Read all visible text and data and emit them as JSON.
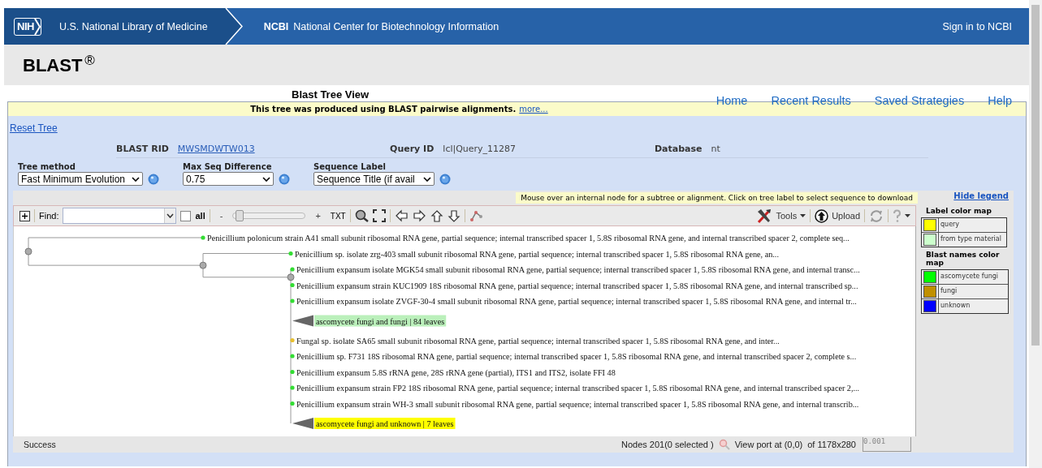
{
  "header": {
    "logo": "NIH",
    "library": "U.S. National Library of Medicine",
    "ncbi": "NCBI",
    "center": "National Center for Biotechnology Information",
    "sign_in": "Sign in to NCBI"
  },
  "app": {
    "title": "BLAST",
    "mark": "®"
  },
  "page_title": "Blast Tree View",
  "nav": [
    "Home",
    "Recent Results",
    "Saved Strategies",
    "Help"
  ],
  "notice": {
    "text": "This tree was produced using BLAST pairwise alignments.",
    "link": "more..."
  },
  "reset_link": "Reset Tree",
  "info": [
    {
      "label": "BLAST RID",
      "value": "MWSMDWTW013",
      "kind": "link"
    },
    {
      "label": "Query ID",
      "value": "lcl|Query_11287",
      "kind": "text"
    },
    {
      "label": "Database",
      "value": "nt",
      "kind": "text"
    }
  ],
  "options": [
    {
      "label": "Tree method",
      "value": "Fast Minimum Evolution"
    },
    {
      "label": "Max Seq Difference",
      "value": "0.75"
    },
    {
      "label": "Sequence Label",
      "value": "Sequence Title (if avail"
    }
  ],
  "hint": "Mouse over an internal node for a subtree or alignment. Click on tree label to select sequence to download",
  "legend": {
    "toggle": "Hide legend",
    "maps": [
      {
        "title": "Label color map",
        "entries": [
          {
            "label": "query",
            "color": "#ffff00"
          },
          {
            "label": "from type material",
            "color": "#ccffcc"
          }
        ]
      },
      {
        "title": "Blast names color map",
        "entries": [
          {
            "label": "ascomycete fungi",
            "color": "#00ff00"
          },
          {
            "label": "fungi",
            "color": "#c09000"
          },
          {
            "label": "unknown",
            "color": "#0000ff"
          }
        ]
      }
    ]
  },
  "toolbar": {
    "find_label": "Find:",
    "all_label": "all",
    "all_checked": false,
    "zoom_minus": "-",
    "zoom_plus": "+",
    "zoom": {
      "level": 0.03
    },
    "txt": "TXT",
    "tools": "Tools",
    "upload": "Upload"
  },
  "tree": {
    "kind": "node",
    "children": [
      {
        "kind": "leaf",
        "label": "Penicillium polonicum strain A41 small subunit ribosomal RNA gene, partial sequence; internal transcribed spacer 1, 5.8S ribosomal RNA gene, and internal transcribed spacer 2, complete seq...",
        "color": "#33dd33"
      },
      {
        "kind": "node",
        "children": [
          {
            "kind": "leaf",
            "label": "Penicillium sp. isolate zrg-403 small subunit ribosomal RNA gene, partial sequence; internal transcribed spacer 1, 5.8S ribosomal RNA gene, an...",
            "color": "#33dd33"
          },
          {
            "kind": "node",
            "children": [
              {
                "kind": "leaf",
                "label": "Penicillium expansum isolate MGK54 small subunit ribosomal RNA gene, partial sequence; internal transcribed spacer 1, 5.8S ribosomal RNA gene, and internal transc...",
                "color": "#33dd33"
              },
              {
                "kind": "leaf",
                "label": "Penicillium expansum strain KUC1909 18S ribosomal RNA gene, partial sequence; internal transcribed spacer 1, 5.8S ribosomal RNA gene, and internal transcribed sp...",
                "color": "#33dd33"
              },
              {
                "kind": "leaf",
                "label": "Penicillium expansum isolate ZVGF-30-4 small subunit ribosomal RNA gene, partial sequence; internal transcribed spacer 1, 5.8S ribosomal RNA gene, and internal tr...",
                "color": "#33dd33"
              },
              {
                "kind": "collapsed",
                "label": "ascomycete fungi and fungi | 84 leaves",
                "color": "#bbf0bb"
              },
              {
                "kind": "leaf",
                "label": "Fungal sp. isolate SA65 small subunit ribosomal RNA gene, partial sequence; internal transcribed spacer 1, 5.8S ribosomal RNA gene, and inter...",
                "color": "#e8c030"
              },
              {
                "kind": "leaf",
                "label": "Penicillium sp. F731 18S ribosomal RNA gene, partial sequence; internal transcribed spacer 1, 5.8S ribosomal RNA gene, and internal transcribed spacer 2, complete s...",
                "color": "#33dd33"
              },
              {
                "kind": "leaf",
                "label": "Penicillium expansum 5.8S rRNA gene, 28S rRNA gene (partial), ITS1 and ITS2, isolate FFI 48",
                "color": "#33dd33"
              },
              {
                "kind": "leaf",
                "label": "Penicillium expansum strain FP2 18S ribosomal RNA gene, partial sequence; internal transcribed spacer 1, 5.8S ribosomal RNA gene, and internal transcribed spacer 2,...",
                "color": "#33dd33"
              },
              {
                "kind": "leaf",
                "label": "Penicillium expansum strain WH-3 small subunit ribosomal RNA gene, partial sequence; internal transcribed spacer 1, 5.8S ribosomal RNA gene, and internal transcrib...",
                "color": "#33dd33"
              },
              {
                "kind": "collapsed",
                "label": "ascomycete fungi and unknown | 7 leaves",
                "color": "#ffff00"
              }
            ]
          }
        ]
      }
    ]
  },
  "status": {
    "message": "Success",
    "nodes": "Nodes 201(0 selected )",
    "viewport": "View port at (0,0)",
    "size": "of 1178x280",
    "scale": "0.001"
  }
}
